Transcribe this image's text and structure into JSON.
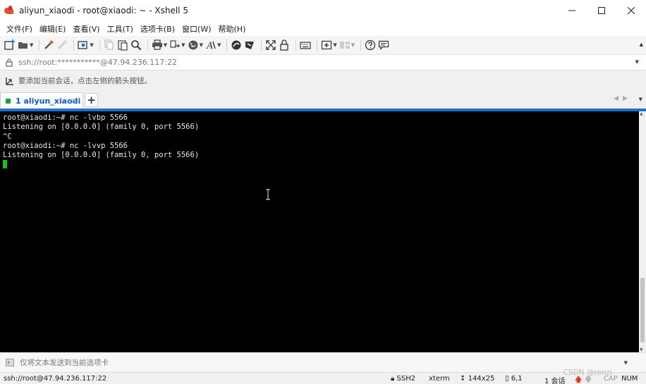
{
  "window": {
    "title": "aliyun_xiaodi - root@xiaodi: ~ - Xshell 5"
  },
  "menu": [
    {
      "label": "文件(F)"
    },
    {
      "label": "编辑(E)"
    },
    {
      "label": "查看(V)"
    },
    {
      "label": "工具(T)"
    },
    {
      "label": "选项卡(B)"
    },
    {
      "label": "窗口(W)"
    },
    {
      "label": "帮助(H)"
    }
  ],
  "toolbar": {
    "icons": [
      "new-session-icon",
      "open-folder-icon",
      "connect-icon",
      "disconnect-icon",
      "properties-icon",
      "copy-icon",
      "paste-icon",
      "find-icon",
      "print-icon",
      "transfer-icon",
      "globe-icon",
      "font-icon",
      "xftp-icon",
      "xmanager-icon",
      "fullscreen-icon",
      "lock-icon",
      "keyboard-icon",
      "new-tab-icon",
      "layout-icon",
      "help-icon",
      "chat-icon"
    ]
  },
  "address": {
    "value": "ssh://root:***********@47.94.236.117:22"
  },
  "hint": {
    "text": "要添加当前会话，点击左侧的箭头按钮。"
  },
  "tabs": [
    {
      "label": "1 aliyun_xiaodi",
      "close": "×",
      "active": true,
      "status_color": "#12a33a"
    }
  ],
  "tab_add_label": "+",
  "terminal": {
    "lines": [
      "root@xiaodi:~# nc -lvbp 5566",
      "Listening on [0.0.0.0] (family 0, port 5566)",
      "^C",
      "root@xiaodi:~# nc -lvvp 5566",
      "Listening on [0.0.0.0] (family 0, port 5566)"
    ],
    "cursor_color": "#12c21e"
  },
  "compose": {
    "placeholder": "仅将文本发送到当前选项卡"
  },
  "status": {
    "connection": "ssh://root@47.94.236.117:22",
    "protocol": "SSH2",
    "terminal_type": "xterm",
    "size": "144x25",
    "position": "6,1",
    "sessions": "1 会话",
    "caps": "CAP",
    "num": "NUM"
  },
  "watermark": "CSDN @renzi",
  "colors": {
    "accent": "#1a73d8",
    "terminal_bg": "#000000",
    "terminal_fg": "#e6e6e6"
  }
}
